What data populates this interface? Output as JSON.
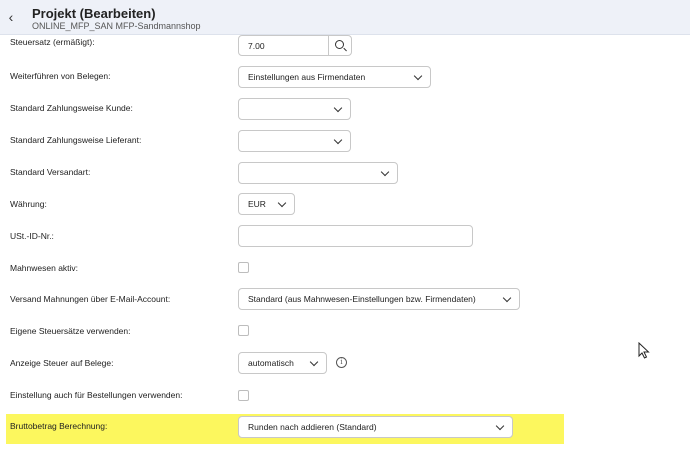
{
  "header": {
    "title": "Projekt (Bearbeiten)",
    "subtitle": "ONLINE_MFP_SAN MFP-Sandmannshop"
  },
  "form": {
    "steuersatz": {
      "label": "Steuersatz (ermäßigt):",
      "value": "7.00"
    },
    "weiterfuehren": {
      "label": "Weiterführen von Belegen:",
      "value": "Einstellungen aus Firmendaten"
    },
    "zahlungsweise_kunde": {
      "label": "Standard Zahlungsweise Kunde:",
      "value": ""
    },
    "zahlungsweise_lieferant": {
      "label": "Standard Zahlungsweise Lieferant:",
      "value": ""
    },
    "versandart": {
      "label": "Standard Versandart:",
      "value": ""
    },
    "waehrung": {
      "label": "Währung:",
      "value": "EUR"
    },
    "ust_id": {
      "label": "USt.-ID-Nr.:",
      "value": ""
    },
    "mahnwesen": {
      "label": "Mahnwesen aktiv:",
      "checked": false
    },
    "versand_mahnungen": {
      "label": "Versand Mahnungen über E-Mail-Account:",
      "value": "Standard (aus Mahnwesen-Einstellungen bzw. Firmendaten)"
    },
    "eigene_steuersaetze": {
      "label": "Eigene Steuersätze verwenden:",
      "checked": false
    },
    "anzeige_steuer": {
      "label": "Anzeige Steuer auf Belege:",
      "value": "automatisch"
    },
    "einstellung_bestellungen": {
      "label": "Einstellung auch für Bestellungen verwenden:",
      "checked": false
    },
    "bruttobetrag": {
      "label": "Bruttobetrag Berechnung:",
      "value": "Runden nach addieren (Standard)"
    }
  },
  "colors": {
    "header_bg": "#eef1f8",
    "highlight": "#fcf75e",
    "border": "#c8c8c8"
  }
}
